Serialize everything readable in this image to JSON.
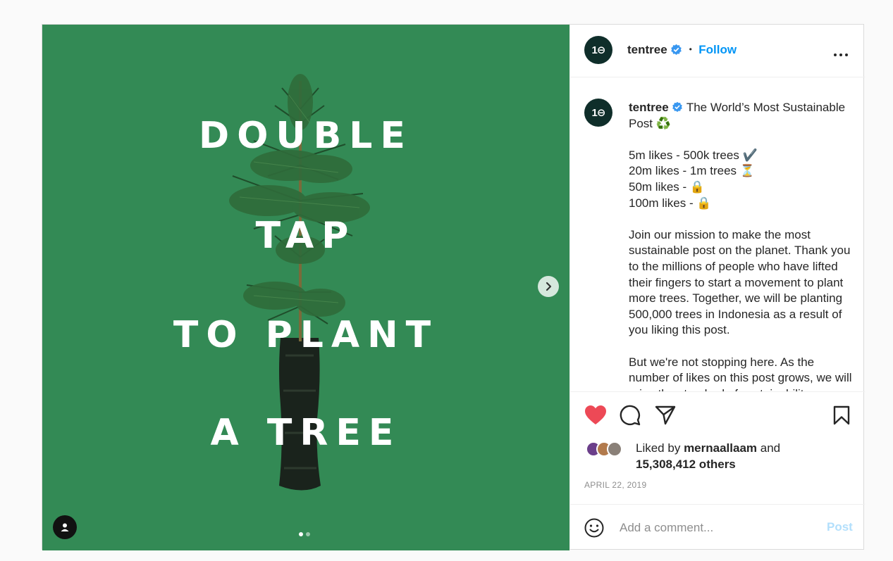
{
  "media": {
    "headline": [
      "DOUBLE",
      "TAP",
      "TO PLANT",
      "A TREE"
    ],
    "carousel_total": 2,
    "carousel_active": 1
  },
  "header": {
    "avatar_text": "1⊖",
    "username": "tentree",
    "separator": "•",
    "follow_label": "Follow",
    "more_icon": "more-horizontal-icon"
  },
  "caption": {
    "username": "tentree",
    "first_line": "The World’s Most Sustainable Post ♻️",
    "milestones": [
      "5m likes - 500k trees ✔️",
      "20m likes - 1m trees ⏳",
      "50m likes - 🔒",
      "100m likes - 🔒"
    ],
    "paragraph1": "Join our mission to make the most sustainable post on the planet. Thank you to the millions of people who have lifted their fingers to start a movement to plant more trees. Together, we will be planting 500,000 trees in Indonesia as a result of you liking this post.",
    "paragraph2": "But we're not stopping here. As the number of likes on this post grows, we will raise the standard of sustainability"
  },
  "actions": {
    "liked_by_prefix": "Liked by",
    "liked_by_user": "mernaallaam",
    "liked_by_and": "and",
    "others_count": "15,308,412 others",
    "date": "APRIL 22, 2019"
  },
  "comment": {
    "placeholder": "Add a comment...",
    "post_label": "Post"
  },
  "colors": {
    "media_bg": "#338a55",
    "like_red": "#ed4956",
    "link_blue": "#0095f6",
    "verified_blue": "#3897f0"
  }
}
